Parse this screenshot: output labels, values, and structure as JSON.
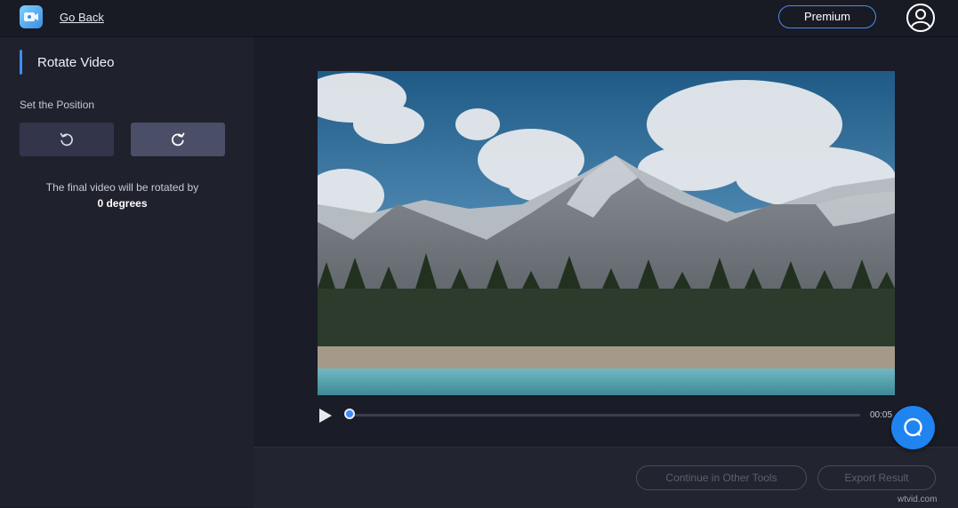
{
  "header": {
    "go_back": "Go Back",
    "premium": "Premium"
  },
  "sidebar": {
    "title": "Rotate Video",
    "position_label": "Set the Position",
    "info_text": "The final video will be rotated by",
    "degrees": "0 degrees"
  },
  "player": {
    "time": "00:05",
    "progress": 0.0
  },
  "footer": {
    "continue_label": "Continue in Other Tools",
    "export_label": "Export Result",
    "watermark": "wtvid.com"
  },
  "colors": {
    "accent": "#3f8cf2",
    "support": "#1f84f0"
  },
  "icons": [
    "app-icon",
    "user-icon",
    "rotate-left-icon",
    "rotate-right-icon",
    "play-icon",
    "support-chat-icon"
  ]
}
